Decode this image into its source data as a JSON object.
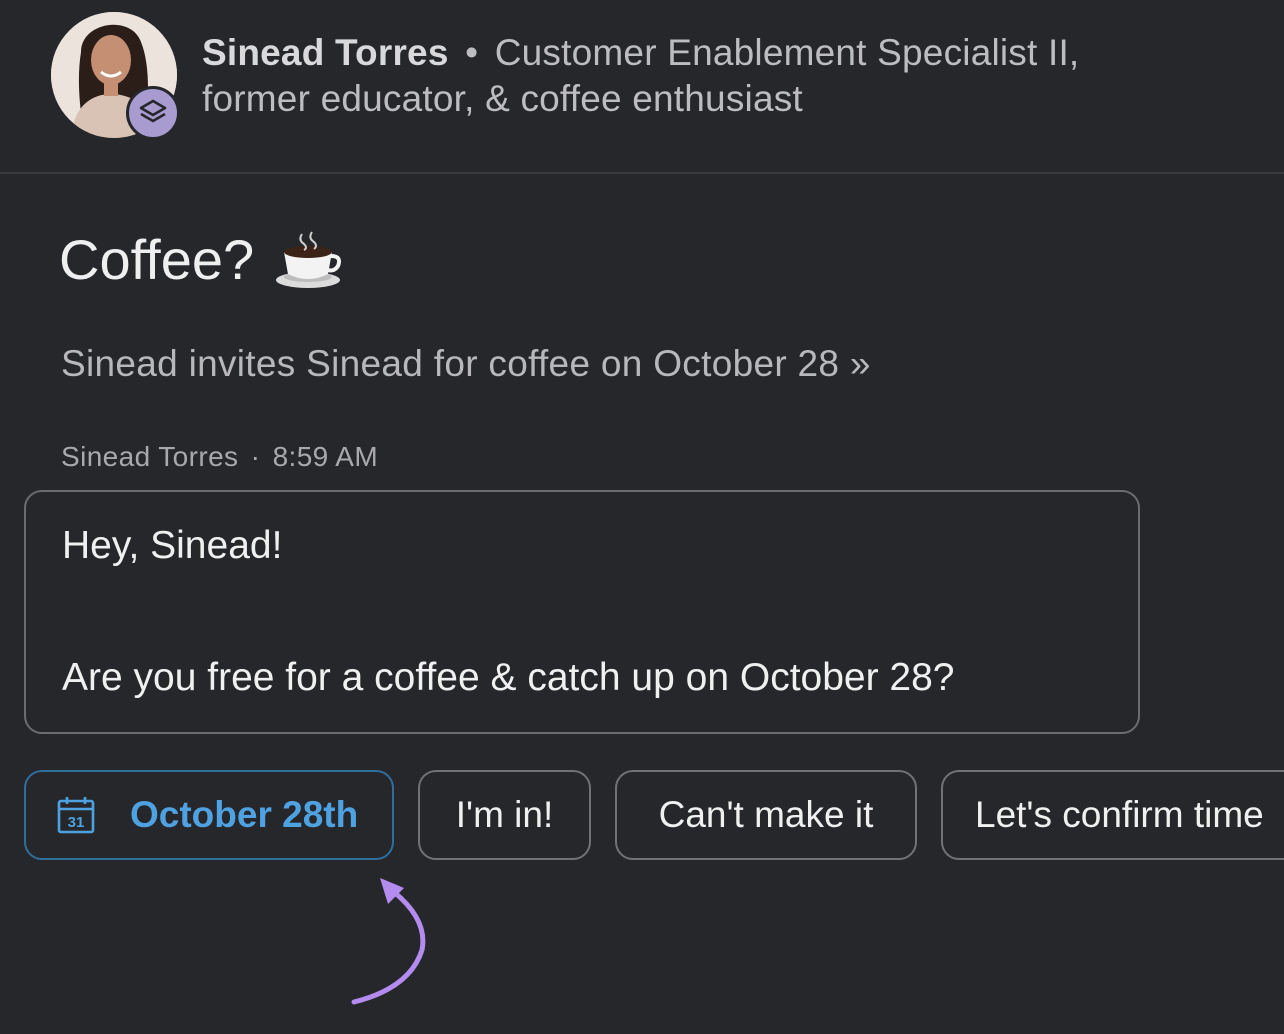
{
  "header": {
    "name": "Sinead Torres",
    "separator": "•",
    "headline_line1": "Customer Enablement Specialist II,",
    "headline_line2": "former educator, & coffee enthusiast"
  },
  "conversation": {
    "title": "Coffee?",
    "title_emoji": "coffee-cup-icon",
    "invite_text": "Sinead invites Sinead for coffee on October 28 »"
  },
  "message": {
    "sender": "Sinead Torres",
    "separator": "·",
    "time": "8:59 AM",
    "line1": "Hey, Sinead!",
    "line2": "Are you free for a coffee & catch up on October 28?"
  },
  "chips": {
    "date_icon_text": "31",
    "date_label": "October 28th",
    "im_in": "I'm in!",
    "cant_make_it": "Can't make it",
    "confirm": "Let's confirm time"
  },
  "colors": {
    "background": "#26272b",
    "accent_blue": "#4fa2e1",
    "badge_purple": "#a89bd0",
    "arrow_purple": "#b48cf0"
  }
}
